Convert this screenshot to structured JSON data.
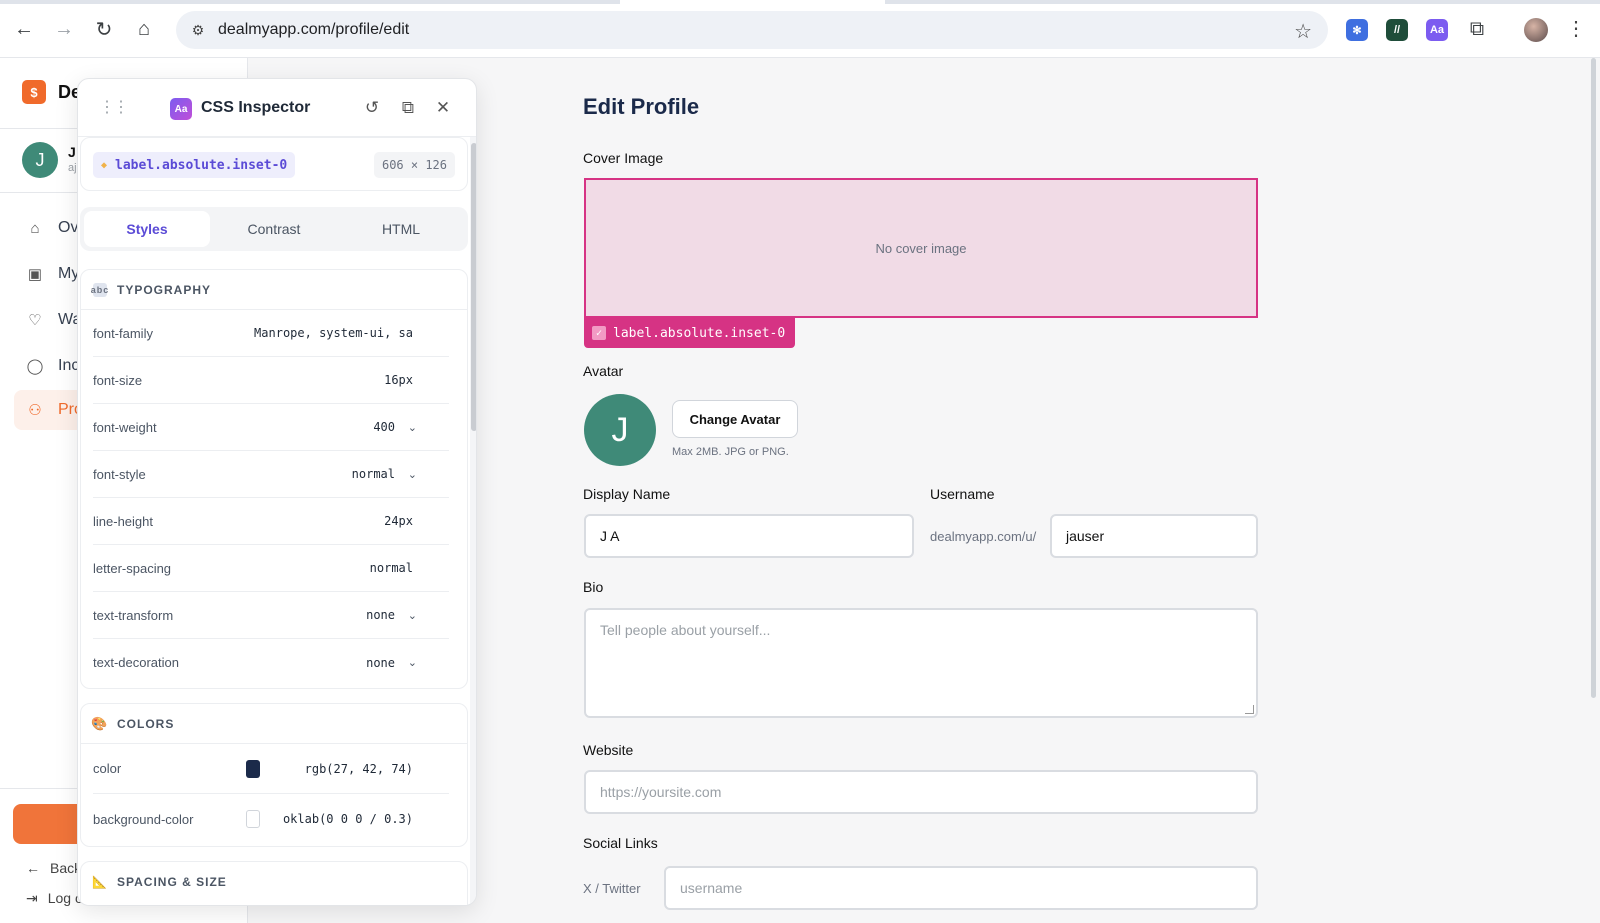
{
  "browser": {
    "url": "dealmyapp.com/profile/edit",
    "back_icon": "←",
    "forward_icon": "→",
    "reload_icon": "↻",
    "home_icon": "⌂",
    "star_icon": "☆",
    "menu_icon": "⋮",
    "extensions": [
      {
        "name": "extension-gear-icon",
        "glyph": "✻",
        "color": "#3f6fe0"
      },
      {
        "name": "extension-check-icon",
        "glyph": "//",
        "color": "#1f4d3a"
      },
      {
        "name": "extension-aa-icon",
        "glyph": "Aa",
        "color": "#7c5cf0"
      }
    ],
    "puzzle_icon": "⧉"
  },
  "sidebar": {
    "brand_logo": "$",
    "brand_text": "De",
    "user_initial": "J",
    "user_name": "J",
    "user_sub": "aj",
    "items": [
      {
        "label": "Ov",
        "icon": "⌂"
      },
      {
        "label": "My",
        "icon": "▣"
      },
      {
        "label": "Wa",
        "icon": "♡"
      },
      {
        "label": "Inc",
        "icon": "◯"
      },
      {
        "label": "Pro",
        "icon": "⚇"
      }
    ],
    "back_label": "Back",
    "back_icon": "←",
    "logout_label": "Log o",
    "logout_icon": "⇥"
  },
  "inspector": {
    "title": "CSS Inspector",
    "logo": "Aa",
    "drag_icon": "⋮⋮",
    "reset_icon": "↺",
    "copy_icon": "⧉",
    "close_icon": "✕",
    "selector": "label.absolute.inset-0",
    "dimensions": "606 × 126",
    "tabs": [
      "Styles",
      "Contrast",
      "HTML"
    ],
    "active_tab": "Styles",
    "typography": {
      "heading": "TYPOGRAPHY",
      "props": [
        {
          "name": "font-family",
          "value": "Manrope, system-ui, sa",
          "caret": false
        },
        {
          "name": "font-size",
          "value": "16px",
          "caret": false
        },
        {
          "name": "font-weight",
          "value": "400",
          "caret": true
        },
        {
          "name": "font-style",
          "value": "normal",
          "caret": true
        },
        {
          "name": "line-height",
          "value": "24px",
          "caret": false
        },
        {
          "name": "letter-spacing",
          "value": "normal",
          "caret": false
        },
        {
          "name": "text-transform",
          "value": "none",
          "caret": true
        },
        {
          "name": "text-decoration",
          "value": "none",
          "caret": true
        }
      ]
    },
    "colors": {
      "heading": "COLORS",
      "props": [
        {
          "name": "color",
          "value": "rgb(27, 42, 74)",
          "swatch": "#1b2a4a"
        },
        {
          "name": "background-color",
          "value": "oklab(0 0 0 / 0.3)",
          "swatch": "#ffffff"
        }
      ]
    },
    "spacing_heading": "SPACING & SIZE"
  },
  "form": {
    "title": "Edit Profile",
    "cover_label": "Cover Image",
    "cover_empty": "No cover image",
    "cover_tag": "label.absolute.inset-0",
    "avatar_label": "Avatar",
    "avatar_initial": "J",
    "change_avatar": "Change Avatar",
    "avatar_hint": "Max 2MB. JPG or PNG.",
    "display_name_label": "Display Name",
    "display_name_value": "J A",
    "username_label": "Username",
    "username_prefix": "dealmyapp.com/u/",
    "username_value": "jauser",
    "bio_label": "Bio",
    "bio_placeholder": "Tell people about yourself...",
    "website_label": "Website",
    "website_placeholder": "https://yoursite.com",
    "social_label": "Social Links",
    "twitter_prefix": "X / Twitter",
    "twitter_placeholder": "username"
  },
  "colors": {
    "accent": "#f06a2b",
    "highlight": "#d63384",
    "inspector_accent": "#5b4bd6",
    "avatar": "#3f8a78"
  }
}
